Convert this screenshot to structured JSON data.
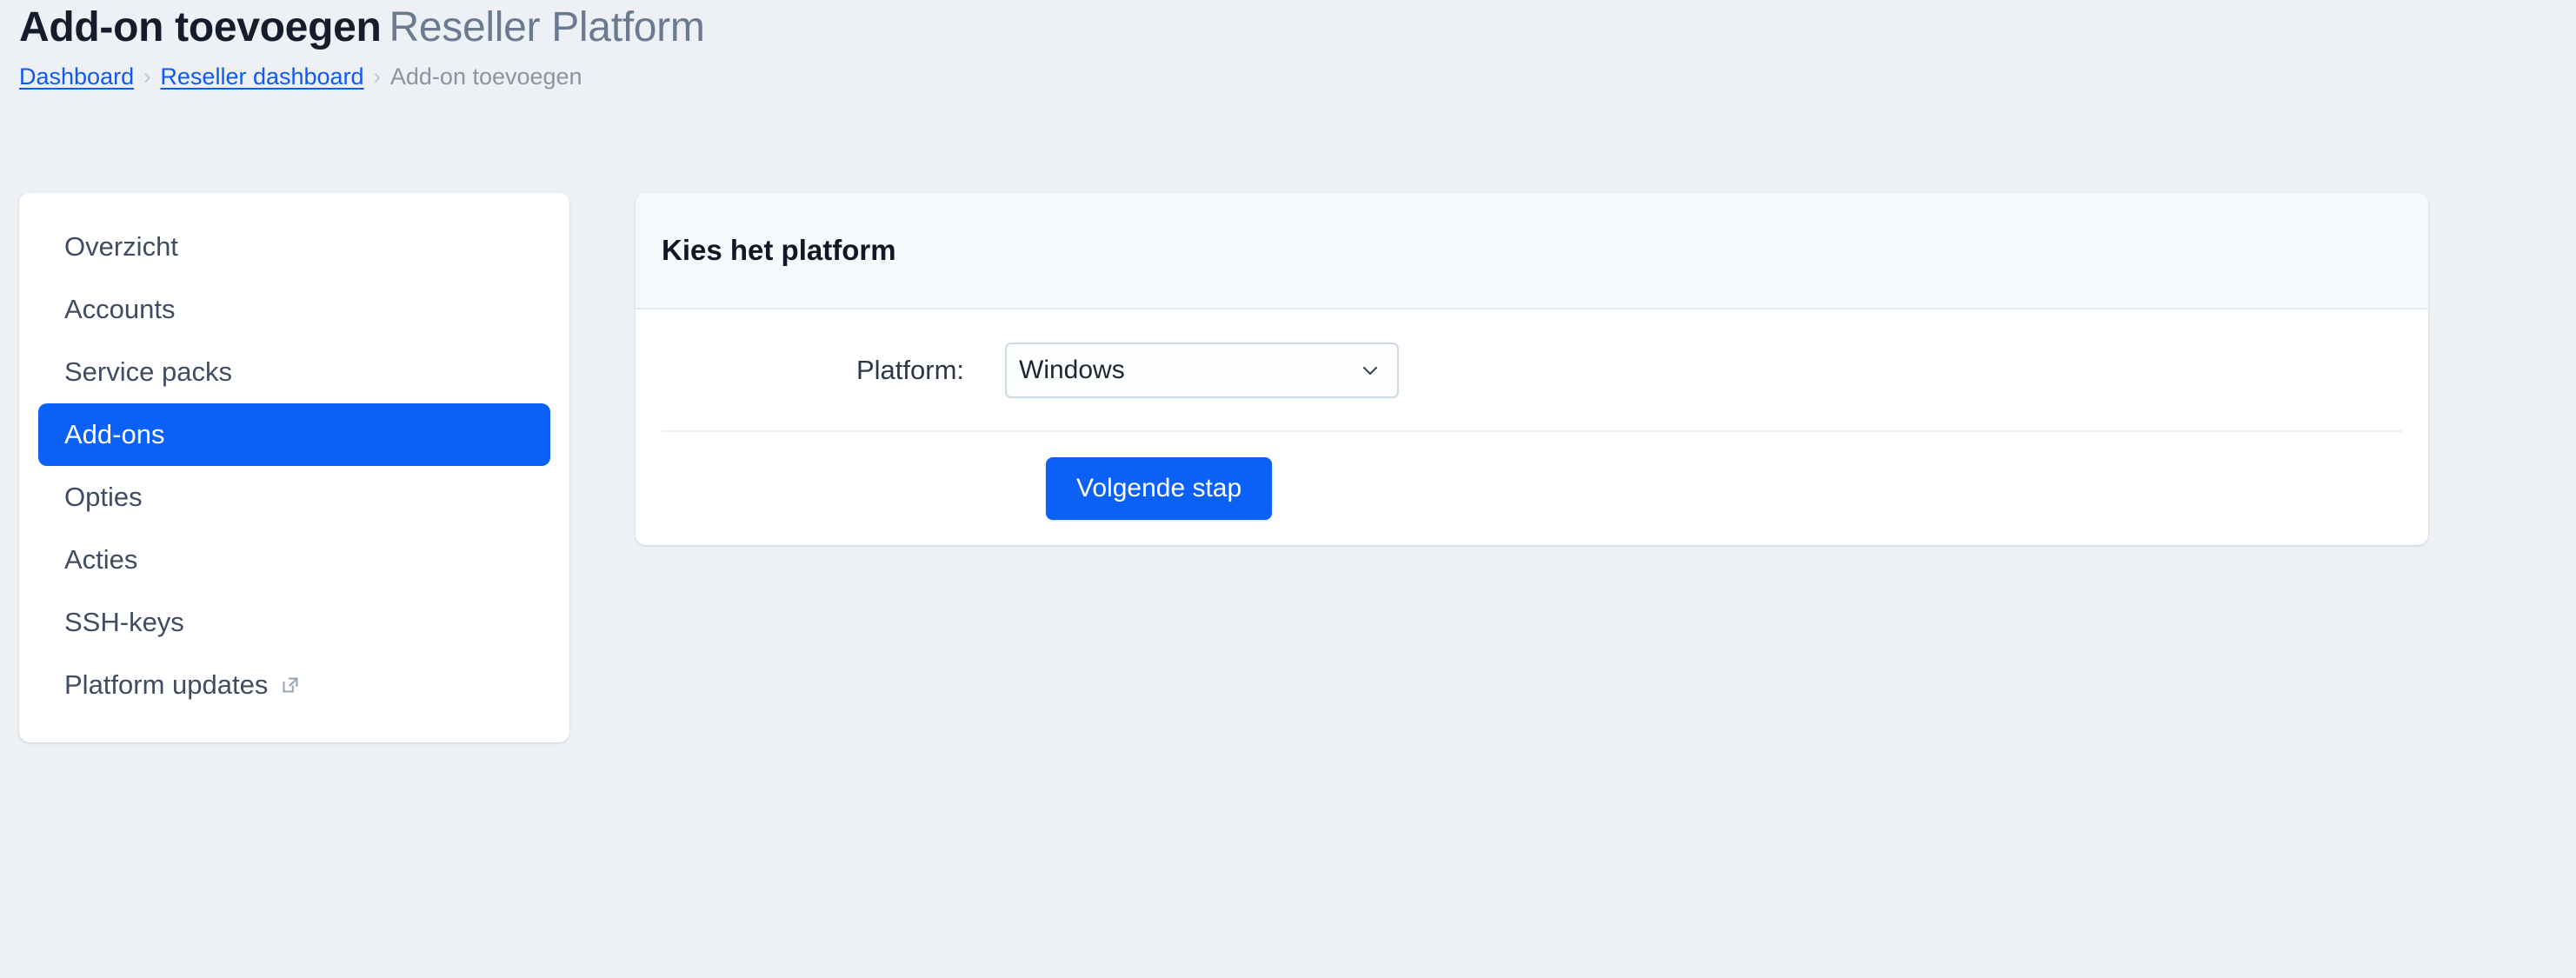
{
  "header": {
    "title_main": "Add-on toevoegen",
    "title_sub": "Reseller Platform",
    "breadcrumb": {
      "items": [
        {
          "label": "Dashboard",
          "type": "link"
        },
        {
          "label": "Reseller dashboard",
          "type": "link"
        },
        {
          "label": "Add-on toevoegen",
          "type": "current"
        }
      ],
      "separator": "›"
    }
  },
  "sidebar": {
    "items": [
      {
        "label": "Overzicht",
        "active": false,
        "external": false
      },
      {
        "label": "Accounts",
        "active": false,
        "external": false
      },
      {
        "label": "Service packs",
        "active": false,
        "external": false
      },
      {
        "label": "Add-ons",
        "active": true,
        "external": false
      },
      {
        "label": "Opties",
        "active": false,
        "external": false
      },
      {
        "label": "Acties",
        "active": false,
        "external": false
      },
      {
        "label": "SSH-keys",
        "active": false,
        "external": false
      },
      {
        "label": "Platform updates",
        "active": false,
        "external": true
      }
    ]
  },
  "main": {
    "card_title": "Kies het platform",
    "form": {
      "platform_label": "Platform:",
      "platform_value": "Windows",
      "platform_options": [
        "Windows"
      ]
    },
    "submit_label": "Volgende stap"
  },
  "colors": {
    "accent": "#0b61f5",
    "link": "#1059f5",
    "page_bg": "#edf1f5",
    "card_bg": "#ffffff",
    "card_header_bg": "#f6f9fc",
    "title_main": "#151c2c",
    "title_sub": "#6b7a90"
  },
  "icons": {
    "breadcrumb_separator": "chevron-right-icon",
    "select_arrow": "chevron-down-icon",
    "external_link": "external-link-icon"
  }
}
